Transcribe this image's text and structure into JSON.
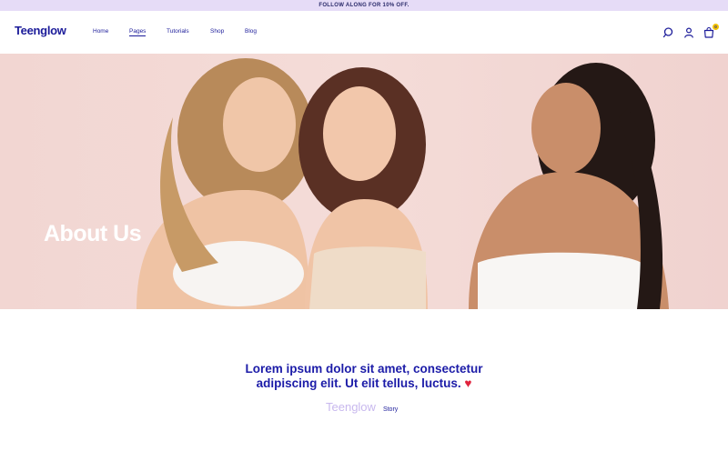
{
  "promo": {
    "text": "FOLLOW ALONG FOR 10% OFF."
  },
  "header": {
    "logo": "Teenglow",
    "nav": [
      {
        "label": "Home"
      },
      {
        "label": "Pages",
        "active": true
      },
      {
        "label": "Tutorials"
      },
      {
        "label": "Shop"
      },
      {
        "label": "Blog"
      }
    ],
    "icons": [
      "search-icon",
      "user-icon",
      "cart-icon"
    ],
    "cart_count": "0"
  },
  "hero": {
    "title": "About Us",
    "background_color": "#f2d6d2"
  },
  "story": {
    "heading_line1": "Lorem ipsum dolor sit amet, consectetur",
    "heading_line2": "adipiscing elit. Ut elit tellus, luctus.",
    "heart": "♥",
    "brand": "Teenglow",
    "label": "Story"
  },
  "colors": {
    "brand": "#1c1c9a",
    "promo_bg": "#e6dcf7",
    "badge": "#f2c200",
    "heart": "#e0233d",
    "brand_light": "#c8b8ee"
  }
}
